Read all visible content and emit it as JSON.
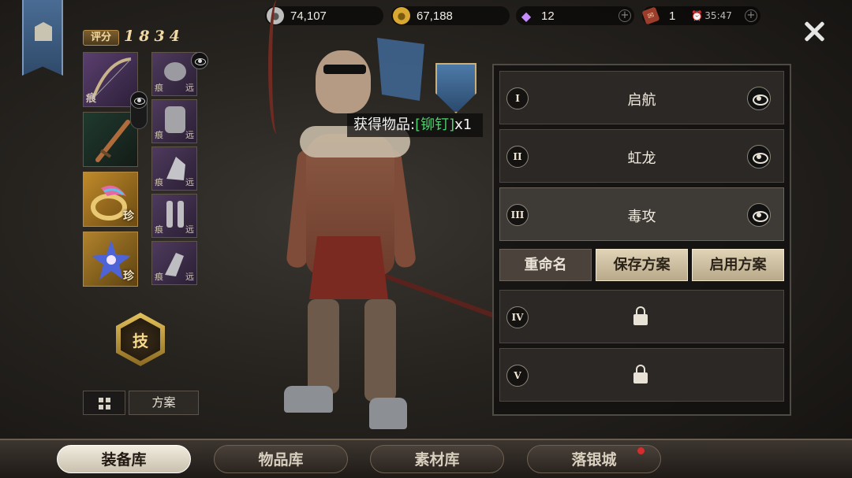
{
  "resources": {
    "silver": {
      "value": "74,107",
      "icon": "silver-coin-icon",
      "color": "#c9c9c9"
    },
    "gold": {
      "value": "67,188",
      "icon": "gold-coin-icon",
      "color": "#e2b43c"
    },
    "diamond": {
      "value": "12",
      "icon": "diamond-icon",
      "color": "#c58cff"
    },
    "ticket": {
      "value": "1",
      "icon": "ticket-icon",
      "color": "#c0503a"
    },
    "timer": "35:47"
  },
  "score": {
    "label": "评分",
    "value": "1834"
  },
  "slots": {
    "small_tag_a": "痕",
    "small_tag_b": "远",
    "rare_tag": "珍"
  },
  "skill_label": "技",
  "plan_button": "方案",
  "toast": {
    "prefix": "获得物品:",
    "item": "[铆钉]",
    "count": "x1",
    "item_color": "#4fd06e"
  },
  "schemes": [
    {
      "numeral": "I",
      "name": "启航",
      "locked": false
    },
    {
      "numeral": "II",
      "name": "虹龙",
      "locked": false
    },
    {
      "numeral": "III",
      "name": "毒攻",
      "locked": false,
      "selected": true
    },
    {
      "numeral": "IV",
      "name": "",
      "locked": true
    },
    {
      "numeral": "V",
      "name": "",
      "locked": true
    }
  ],
  "panel_buttons": {
    "rename": "重命名",
    "save": "保存方案",
    "apply": "启用方案"
  },
  "tabs": [
    {
      "label": "装备库",
      "active": true
    },
    {
      "label": "物品库",
      "active": false
    },
    {
      "label": "素材库",
      "active": false
    },
    {
      "label": "落银城",
      "active": false,
      "notification": true
    }
  ],
  "colors": {
    "accent_gold": "#e2c06a",
    "panel_bg": "#2b2825",
    "active_tab": "#f1ecdf"
  }
}
